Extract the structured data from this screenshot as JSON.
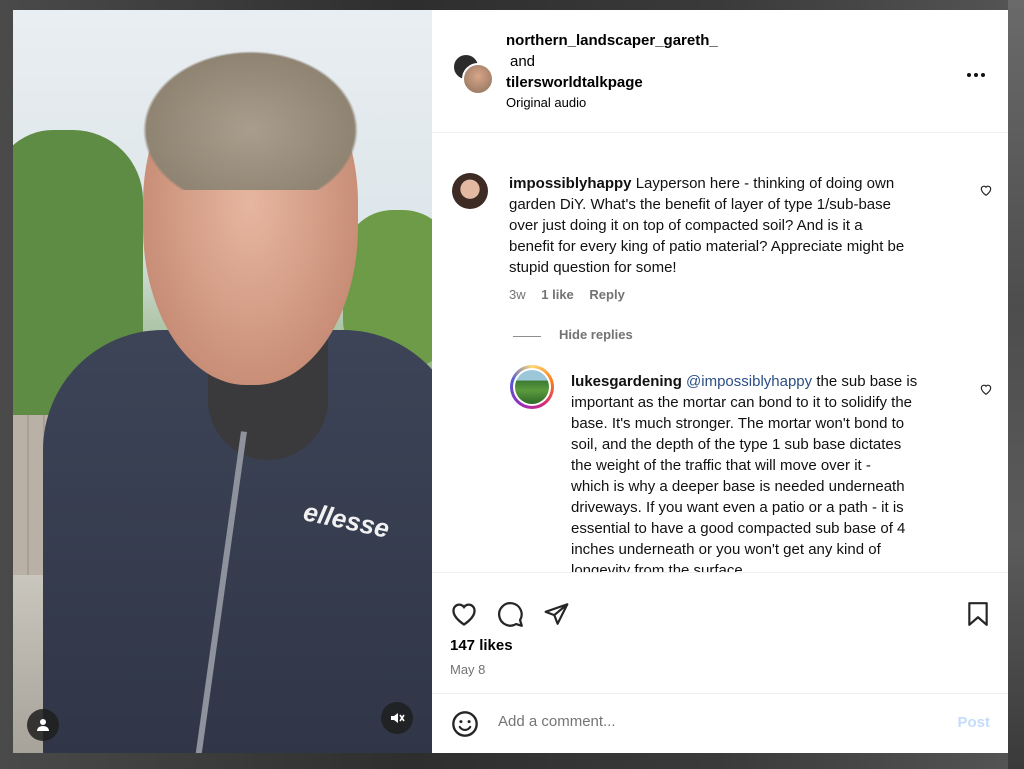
{
  "header": {
    "user1": "northern_landscaper_gareth_",
    "and": "and",
    "user2": "tilersworldtalkpage",
    "audio": "Original audio",
    "more_icon": "more-horizontal-icon"
  },
  "comments": [
    {
      "username": "impossiblyhappy",
      "lines": [
        "Layperson here - thinking of doing own",
        "garden DiY. What's the benefit of layer of type 1/sub-base",
        "over just doing it on top of compacted soil? And is it a",
        "benefit for every king of patio material? Appreciate might be",
        "stupid question for some!"
      ],
      "age": "3w",
      "likes": "1 like",
      "reply": "Reply"
    }
  ],
  "hide_replies": "Hide replies",
  "reply": {
    "username": "lukesgardening",
    "mention": "@impossiblyhappy",
    "lines": [
      "the sub base is",
      "important as the mortar can bond to it to solidify the",
      "base. It's much stronger. The mortar won't bond to",
      "soil, and the depth of the type 1 sub base dictates",
      "the weight of the traffic that will move over it -",
      "which is why a deeper base is needed underneath",
      "driveways. If you want even a patio or a path - it is",
      "essential to have a good compacted sub base of 4",
      "inches underneath or you won't get any kind of",
      "longevity from the surface"
    ]
  },
  "post": {
    "likes": "147 likes",
    "date": "May 8"
  },
  "add_comment": {
    "placeholder": "Add a comment...",
    "post_label": "Post"
  },
  "video": {
    "shirt_logo": "ellesse"
  },
  "colors": {
    "accent": "#0095f6",
    "post_disabled": "#c4dcfb",
    "mention": "#2b4e86",
    "muted": "#737373"
  }
}
